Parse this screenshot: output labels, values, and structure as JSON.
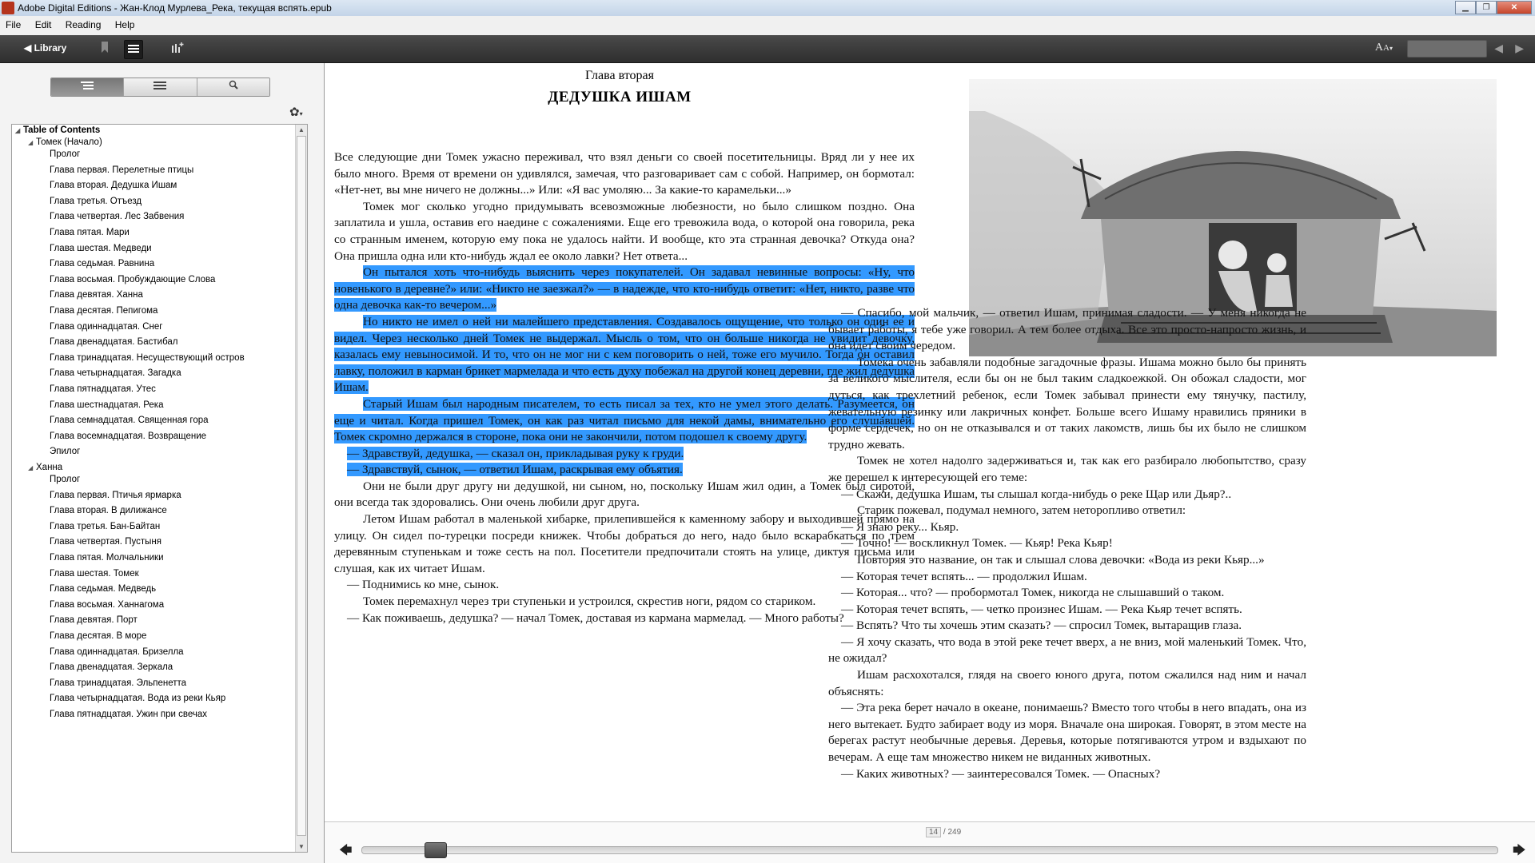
{
  "window": {
    "title": "Adobe Digital Editions - Жан-Клод Мурлева_Река, текущая вспять.epub"
  },
  "menu": [
    "File",
    "Edit",
    "Reading",
    "Help"
  ],
  "toolbar": {
    "library_label": "◀ Library",
    "font_label": "A",
    "font_sub": "A"
  },
  "sidebar": {
    "tabs": [
      "toc",
      "bookmarks",
      "search"
    ],
    "toc_title": "Table of Contents",
    "books": [
      {
        "title": "Томек (Начало)",
        "items": [
          "Пролог",
          "Глава первая. Перелетные птицы",
          "Глава вторая. Дедушка Ишам",
          "Глава третья. Отъезд",
          "Глава четвертая. Лес Забвения",
          "Глава пятая. Мари",
          "Глава шестая. Медведи",
          "Глава седьмая. Равнина",
          "Глава восьмая. Пробуждающие Слова",
          "Глава девятая. Ханна",
          "Глава десятая. Пепигома",
          "Глава одиннадцатая. Снег",
          "Глава двенадцатая. Бастибал",
          "Глава тринадцатая. Несуществующий остров",
          "Глава четырнадцатая. Загадка",
          "Глава пятнадцатая. Утес",
          "Глава шестнадцатая. Река",
          "Глава семнадцатая. Священная гора",
          "Глава восемнадцатая. Возвращение",
          "Эпилог"
        ]
      },
      {
        "title": "Ханна",
        "items": [
          "Пролог",
          "Глава первая. Птичья ярмарка",
          "Глава вторая. В дилижансе",
          "Глава третья. Бан-Байтан",
          "Глава четвертая. Пустыня",
          "Глава пятая. Молчальники",
          "Глава шестая. Томек",
          "Глава седьмая. Медведь",
          "Глава восьмая. Ханнагома",
          "Глава девятая. Порт",
          "Глава десятая. В море",
          "Глава одиннадцатая. Бризелла",
          "Глава двенадцатая. Зеркала",
          "Глава тринадцатая. Эльпенетта",
          "Глава четырнадцатая. Вода из реки Кьяр",
          "Глава пятнадцатая. Ужин при свечах"
        ]
      }
    ]
  },
  "chapter": {
    "subtitle": "Глава вторая",
    "title": "ДЕДУШКА ИШАМ"
  },
  "left_paragraphs": [
    {
      "text": "Все следующие дни Томек ужасно переживал, что взял деньги со своей посетительницы. Вряд ли у нее их было много. Время от времени он удивлялся, замечая, что разговаривает сам с собой. Например, он бормотал: «Нет-нет, вы мне ничего не должны...» Или: «Я вас умоляю... За какие-то карамельки...»",
      "hl": false,
      "first": true
    },
    {
      "text": "Томек мог сколько угодно придумывать всевозможные любезности, но было слишком поздно. Она заплатила и ушла, оставив его наедине с сожалениями. Еще его тревожила вода, о которой она говорила, река со странным именем, которую ему пока не удалось найти. И вообще, кто эта странная девочка? Откуда она? Она пришла одна или кто-нибудь ждал ее около лавки? Нет ответа...",
      "hl": false
    },
    {
      "text": "Он пытался хоть что-нибудь выяснить через покупателей. Он задавал невинные вопросы: «Ну, что новенького в деревне?» или: «Никто не заезжал?» — в надежде, что кто-нибудь ответит: «Нет, никто, разве что одна девочка как-то вечером...»",
      "hl": true
    },
    {
      "text": "Но никто не имел о ней ни малейшего представления. Создавалось ощущение, что только он один ее и видел. Через несколько дней Томек не выдержал. Мысль о том, что он больше никогда не увидит девочку, казалась ему невыносимой. И то, что он не мог ни с кем поговорить о ней, тоже его мучило. Тогда он оставил лавку, положил в карман брикет мармелада и что есть духу побежал на другой конец деревни, где жил дедушка Ишам.",
      "hl": true
    },
    {
      "text": "Старый Ишам был народным писателем, то есть писал за тех, кто не умел этого делать. Разумеется, он еще и читал. Когда пришел Томек, он как раз читал письмо для некой дамы, внимательно его слушавшей. Томек скромно держался в стороне, пока они не закончили, потом подошел к своему другу.",
      "hl": true
    },
    {
      "text": "— Здравствуй, дедушка, — сказал он, прикладывая руку к груди.",
      "hl": true,
      "dlg": true
    },
    {
      "text": "— Здравствуй, сынок, — ответил Ишам, раскрывая ему объятия.",
      "hl": true,
      "dlg": true
    },
    {
      "text": "Они не были друг другу ни дедушкой, ни сыном, но, поскольку Ишам жил один, а Томек был сиротой, они всегда так здоровались. Они очень любили друг друга.",
      "hl": false
    },
    {
      "text": "Летом Ишам работал в маленькой хибарке, прилепившейся к каменному забору и выходившей прямо на улицу. Он сидел по-турецки посреди книжек. Чтобы добраться до него, надо было вскарабкаться по трем деревянным ступенькам и тоже сесть на пол. Посетители предпочитали стоять на улице, диктуя письма или слушая, как их читает Ишам.",
      "hl": false
    },
    {
      "text": "— Поднимись ко мне, сынок.",
      "hl": false,
      "dlg": true
    },
    {
      "text": "Томек перемахнул через три ступеньки и устроился, скрестив ноги, рядом со стариком.",
      "hl": false
    },
    {
      "text": "— Как поживаешь, дедушка? — начал Томек, доставая из кармана мармелад. — Много работы?",
      "hl": false,
      "dlg": true
    }
  ],
  "right_paragraphs": [
    {
      "text": "— Спасибо, мой мальчик, — ответил Ишам, принимая сладости. — У меня никогда не бывает работы, я тебе уже говорил. А тем более отдыха. Все это просто-напросто жизнь, и она идет своим чередом.",
      "dlg": true
    },
    {
      "text": "Томека очень забавляли подобные загадочные фразы. Ишама можно было бы принять за великого мыслителя, если бы он не был таким сладкоежкой. Он обожал сладости, мог дуться, как трехлетний ребенок, если Томек забывал принести ему тянучку, пастилу, жевательную резинку или лакричных конфет. Больше всего Ишаму нравились пряники в форме сердечек, но он не отказывался и от таких лакомств, лишь бы их было не слишком трудно жевать."
    },
    {
      "text": "Томек не хотел надолго задерживаться и, так как его разбирало любопытство, сразу же перешел к интересующей его теме:"
    },
    {
      "text": "— Скажи, дедушка Ишам, ты слышал когда-нибудь о реке Щар или Дьяр?..",
      "dlg": true
    },
    {
      "text": "Старик пожевал, подумал немного, затем неторопливо ответил:"
    },
    {
      "text": "— Я знаю реку... Кьяр.",
      "dlg": true
    },
    {
      "text": "— Точно! — воскликнул Томек. — Кьяр! Река Кьяр!",
      "dlg": true
    },
    {
      "text": "Повторяя это название, он так и слышал слова девочки: «Вода из реки Кьяр...»"
    },
    {
      "text": "— Которая течет вспять... — продолжил Ишам.",
      "dlg": true
    },
    {
      "text": "— Которая... что? — пробормотал Томек, никогда не слышавший о таком.",
      "dlg": true
    },
    {
      "text": "— Которая течет вспять, — четко произнес Ишам. — Река Кьяр течет вспять.",
      "dlg": true
    },
    {
      "text": "— Вспять? Что ты хочешь этим сказать? — спросил Томек, вытаращив глаза.",
      "dlg": true
    },
    {
      "text": "— Я хочу сказать, что вода в этой реке течет вверх, а не вниз, мой маленький Томек. Что, не ожидал?",
      "dlg": true
    },
    {
      "text": "Ишам расхохотался, глядя на своего юного друга, потом сжалился над ним и начал объяснять:"
    },
    {
      "text": "— Эта река берет начало в океане, понимаешь? Вместо того чтобы в него впадать, она из него вытекает. Будто забирает воду из моря. Вначале она широкая. Говорят, в этом месте на берегах растут необычные деревья. Деревья, которые потягиваются утром и вздыхают по вечерам. А еще там множество никем не виданных животных.",
      "dlg": true
    },
    {
      "text": "— Каких животных? — заинтересовался Томек. — Опасных?",
      "dlg": true
    }
  ],
  "pagination": {
    "current": "14",
    "total": "/ 249",
    "progress": 0.056
  }
}
